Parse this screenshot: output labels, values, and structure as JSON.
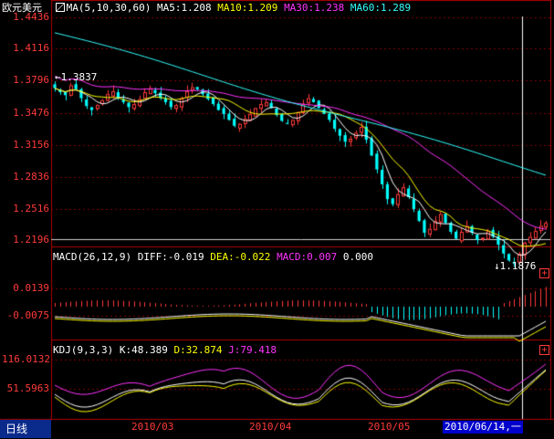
{
  "main_header": {
    "symbol": "欧元美元",
    "ma_label": "MA(5,10,30,60)",
    "ma5": "MA5:1.208",
    "ma10": "MA10:1.209",
    "ma30": "MA30:1.238",
    "ma60": "MA60:1.289"
  },
  "macd_header": {
    "label": "MACD(26,12,9)",
    "diff": "DIFF:-0.019",
    "dea": "DEA:-0.022",
    "macd": "MACD:0.007",
    "zero": "0.000"
  },
  "kdj_header": {
    "label": "KDJ(9,3,3)",
    "k": "K:48.389",
    "d": "D:32.874",
    "j": "J:79.418"
  },
  "price_axis": [
    "1.4436",
    "1.4116",
    "1.3796",
    "1.3476",
    "1.3156",
    "1.2836",
    "1.2516",
    "1.2196"
  ],
  "macd_axis": [
    "0.0139",
    "-0.0075"
  ],
  "kdj_axis": [
    "116.0132",
    "51.5963"
  ],
  "high_marker": "1.3837",
  "low_marker": "1.1876",
  "period_tab": "日线",
  "date_labels": [
    "2010/03",
    "2010/04",
    "2010/05"
  ],
  "cursor_date": "2010/06/14,一",
  "colors": {
    "up": "#ff3a3a",
    "down": "#00ffff",
    "ma5": "#ffffff",
    "ma10": "#ffff00",
    "ma30": "#ff33ff",
    "ma60": "#33ffff",
    "grid": "#800000",
    "border": "#b00000"
  },
  "chart_data": {
    "type": "candlestick",
    "series_note": "EUR/USD daily",
    "closes": [
      1.372,
      1.368,
      1.365,
      1.375,
      1.371,
      1.362,
      1.354,
      1.35,
      1.355,
      1.36,
      1.366,
      1.369,
      1.362,
      1.358,
      1.353,
      1.356,
      1.361,
      1.368,
      1.372,
      1.367,
      1.362,
      1.358,
      1.353,
      1.355,
      1.362,
      1.369,
      1.373,
      1.371,
      1.366,
      1.361,
      1.356,
      1.35,
      1.346,
      1.34,
      1.334,
      1.336,
      1.341,
      1.346,
      1.352,
      1.356,
      1.358,
      1.352,
      1.345,
      1.339,
      1.336,
      1.34,
      1.348,
      1.356,
      1.362,
      1.358,
      1.352,
      1.346,
      1.34,
      1.331,
      1.324,
      1.318,
      1.321,
      1.327,
      1.333,
      1.32,
      1.304,
      1.29,
      1.275,
      1.26,
      1.255,
      1.265,
      1.272,
      1.262,
      1.25,
      1.238,
      1.226,
      1.23,
      1.238,
      1.245,
      1.236,
      1.227,
      1.22,
      1.227,
      1.233,
      1.226,
      1.219,
      1.221,
      1.228,
      1.222,
      1.214,
      1.205,
      1.198,
      1.195,
      1.205,
      1.216,
      1.222,
      1.228,
      1.233,
      1.236
    ]
  }
}
